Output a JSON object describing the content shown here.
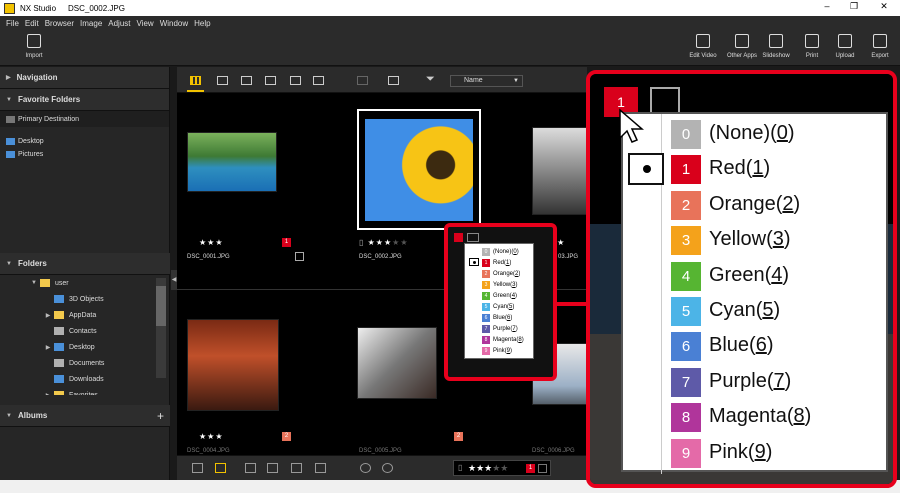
{
  "window": {
    "app_name": "NX Studio",
    "file_name": "DSC_0002.JPG"
  },
  "menu": [
    "File",
    "Edit",
    "Browser",
    "Image",
    "Adjust",
    "View",
    "Window",
    "Help"
  ],
  "toolbar": {
    "import_label": "Import",
    "right_buttons": [
      "Edit Video",
      "Other Apps",
      "Slideshow",
      "Print",
      "Upload",
      "Export"
    ]
  },
  "sidebar": {
    "navigation": "Navigation",
    "favorite_folders": "Favorite Folders",
    "primary_destination": "Primary Destination",
    "favorites": [
      "Desktop",
      "Pictures"
    ],
    "folders": "Folders",
    "tree": [
      {
        "label": "user",
        "indent": 1,
        "arrow": "▼",
        "color": "#f2c94c"
      },
      {
        "label": "3D Objects",
        "indent": 2,
        "arrow": "",
        "color": "#4a90d9"
      },
      {
        "label": "AppData",
        "indent": 2,
        "arrow": "▶",
        "color": "#f2c94c"
      },
      {
        "label": "Contacts",
        "indent": 2,
        "arrow": "",
        "color": "#b0b0b0"
      },
      {
        "label": "Desktop",
        "indent": 2,
        "arrow": "▶",
        "color": "#4a90d9"
      },
      {
        "label": "Documents",
        "indent": 2,
        "arrow": "",
        "color": "#b0b0b0"
      },
      {
        "label": "Downloads",
        "indent": 2,
        "arrow": "",
        "color": "#4a90d9"
      },
      {
        "label": "Favorites",
        "indent": 2,
        "arrow": "▶",
        "color": "#f2c94c"
      }
    ],
    "albums": "Albums",
    "albums_add": "+"
  },
  "view": {
    "sort_label": "Name"
  },
  "thumbnails": [
    {
      "name": "DSC_0001.JPG",
      "rating": 3,
      "label": "1",
      "label_color": "#d9001b"
    },
    {
      "name": "DSC_0002.JPG",
      "rating": 3,
      "label": "",
      "label_color": ""
    },
    {
      "name": "03.JPG",
      "rating": 3,
      "label": "",
      "label_color": ""
    },
    {
      "name": "DSC_0004.JPG",
      "rating": 3,
      "label": "2",
      "label_color": "#e8735a"
    },
    {
      "name": "DSC_0005.JPG",
      "rating": 0,
      "label": "2",
      "label_color": "#e8735a"
    },
    {
      "name": "DSC_0006.JPG",
      "rating": 0,
      "label": "",
      "label_color": ""
    }
  ],
  "bottom": {
    "rating": 3,
    "label": "1"
  },
  "labels_menu": [
    {
      "num": "0",
      "name": "(None)",
      "key": "0",
      "color": "#b3b3b3"
    },
    {
      "num": "1",
      "name": "Red",
      "key": "1",
      "color": "#d9001b"
    },
    {
      "num": "2",
      "name": "Orange",
      "key": "2",
      "color": "#e8735a"
    },
    {
      "num": "3",
      "name": "Yellow",
      "key": "3",
      "color": "#f4a21b"
    },
    {
      "num": "4",
      "name": "Green",
      "key": "4",
      "color": "#56b532"
    },
    {
      "num": "5",
      "name": "Cyan",
      "key": "5",
      "color": "#4cb4e7"
    },
    {
      "num": "6",
      "name": "Blue",
      "key": "6",
      "color": "#4a80d4"
    },
    {
      "num": "7",
      "name": "Purple",
      "key": "7",
      "color": "#5e5aa8"
    },
    {
      "num": "8",
      "name": "Magenta",
      "key": "8",
      "color": "#b0359b"
    },
    {
      "num": "9",
      "name": "Pink",
      "key": "9",
      "color": "#e46aa8"
    }
  ],
  "selected_label_index": 1
}
